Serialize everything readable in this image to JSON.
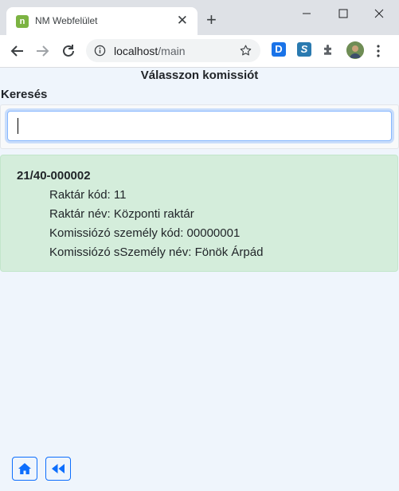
{
  "browser": {
    "tab_title": "NM Webfelület",
    "favicon_text": "n",
    "url_host": "localhost",
    "url_path": "/main",
    "extensions": {
      "d_label": "D",
      "s_label": "S"
    }
  },
  "page": {
    "title": "Válasszon komissiót",
    "search": {
      "label": "Keresés",
      "value": "",
      "placeholder": ""
    },
    "results": [
      {
        "title": "21/40-000002",
        "lines": [
          "Raktár kód: 11",
          "Raktár név: Központi raktár",
          "Komissiózó személy kód: 00000001",
          "Komissiózó sSzemély név: Fönök Árpád"
        ]
      }
    ]
  },
  "colors": {
    "page_bg": "#eff5fc",
    "card_bg": "#d4eddb",
    "accent": "#0d6efd"
  },
  "icons": [
    "home-icon",
    "rewind-icon"
  ]
}
